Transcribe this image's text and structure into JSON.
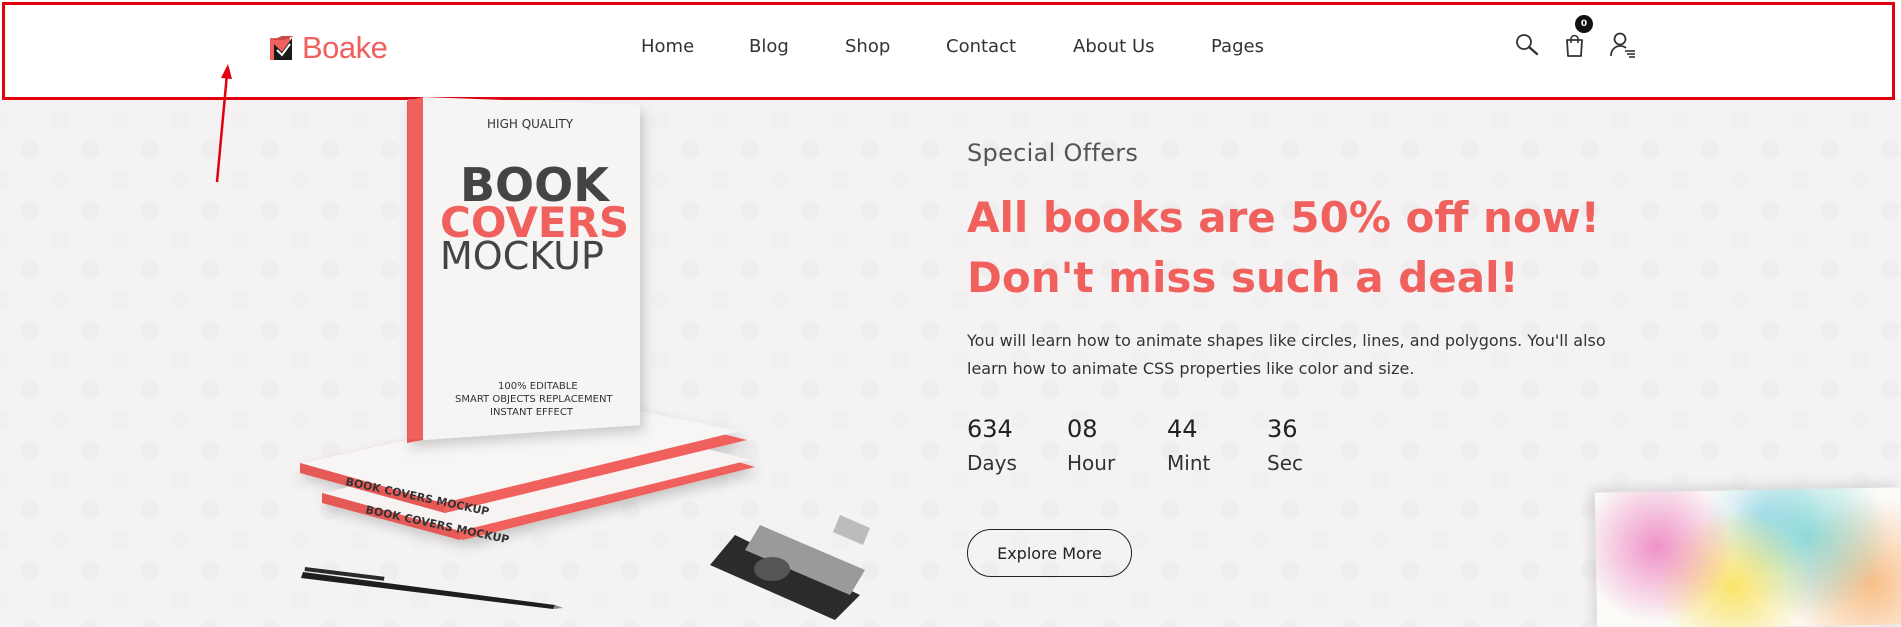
{
  "header": {
    "logo_text": "Boake",
    "nav": [
      {
        "label": "Home"
      },
      {
        "label": "Blog"
      },
      {
        "label": "Shop"
      },
      {
        "label": "Contact"
      },
      {
        "label": "About Us"
      },
      {
        "label": "Pages"
      }
    ],
    "cart_count": "0",
    "icons": [
      "search-icon",
      "cart-icon",
      "user-account-icon"
    ]
  },
  "hero": {
    "subtitle": "Special Offers",
    "headline": "All books are 50% off now! Don't miss such a deal!",
    "description": "You will learn how to animate shapes like circles, lines, and polygons. You'll also learn how to animate CSS properties like color and size.",
    "countdown": [
      {
        "value": "634",
        "label": "Days"
      },
      {
        "value": "08",
        "label": "Hour"
      },
      {
        "value": "44",
        "label": "Mint"
      },
      {
        "value": "36",
        "label": "Sec"
      }
    ],
    "cta_label": "Explore More"
  },
  "book": {
    "top_label": "HIGH QUALITY",
    "line1": "BOOK",
    "line2": "COVERS",
    "line3": "MOCKUP",
    "bottom1": "100% EDITABLE",
    "bottom2": "SMART OBJECTS REPLACEMENT",
    "bottom3": "INSTANT EFFECT",
    "spine": "BOOK COVERS MOCKUP",
    "spine_brand": "COVERS"
  },
  "colors": {
    "accent": "#f0605d",
    "annotation": "#e3000f"
  }
}
